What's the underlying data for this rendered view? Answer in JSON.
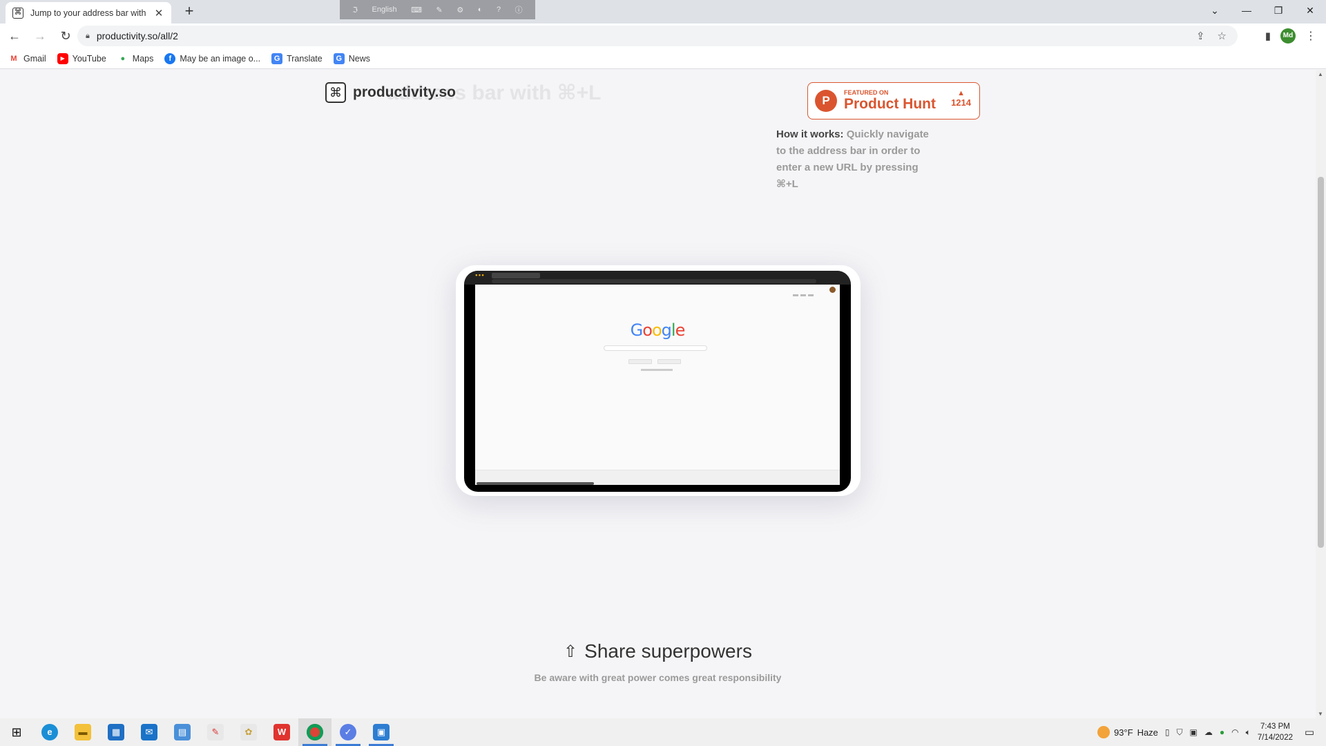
{
  "browser": {
    "tab_title": "Jump to your address bar with",
    "tab_favicon": "⌘",
    "url": "productivity.so/all/2",
    "profile_initials": "Md",
    "ime_language": "English"
  },
  "bookmarks": [
    {
      "label": "Gmail",
      "icon": "gmail-icon",
      "glyph": "M",
      "color": "#ea4335"
    },
    {
      "label": "YouTube",
      "icon": "youtube-icon",
      "glyph": "▶",
      "color": "#ff0000"
    },
    {
      "label": "Maps",
      "icon": "maps-icon",
      "glyph": "●",
      "color": "#34a853"
    },
    {
      "label": "May be an image o...",
      "icon": "facebook-icon",
      "glyph": "f",
      "color": "#1877f2"
    },
    {
      "label": "Translate",
      "icon": "translate-icon",
      "glyph": "G",
      "color": "#4285f4"
    },
    {
      "label": "News",
      "icon": "news-icon",
      "glyph": "G",
      "color": "#4285f4"
    }
  ],
  "page": {
    "logo_symbol": "⌘",
    "logo_name": "productivity.so",
    "ghost_heading": "address bar with ⌘+L",
    "product_hunt": {
      "featured_label": "FEATURED ON",
      "name": "Product Hunt",
      "votes": "1214"
    },
    "how_it_works_label": "How it works:",
    "how_it_works_text": "Quickly navigate to the address bar in order to enter a new URL by pressing ⌘+L",
    "video": {
      "google_letters": [
        "G",
        "o",
        "o",
        "g",
        "l",
        "e"
      ]
    },
    "share_title": "Share superpowers",
    "share_subtitle": "Be aware with great power comes great responsibility"
  },
  "taskbar": {
    "weather_temp": "93°F",
    "weather_desc": "Haze",
    "time": "7:43 PM",
    "date": "7/14/2022"
  },
  "colors": {
    "product_hunt": "#da552f",
    "page_bg": "#f5f5f7"
  }
}
